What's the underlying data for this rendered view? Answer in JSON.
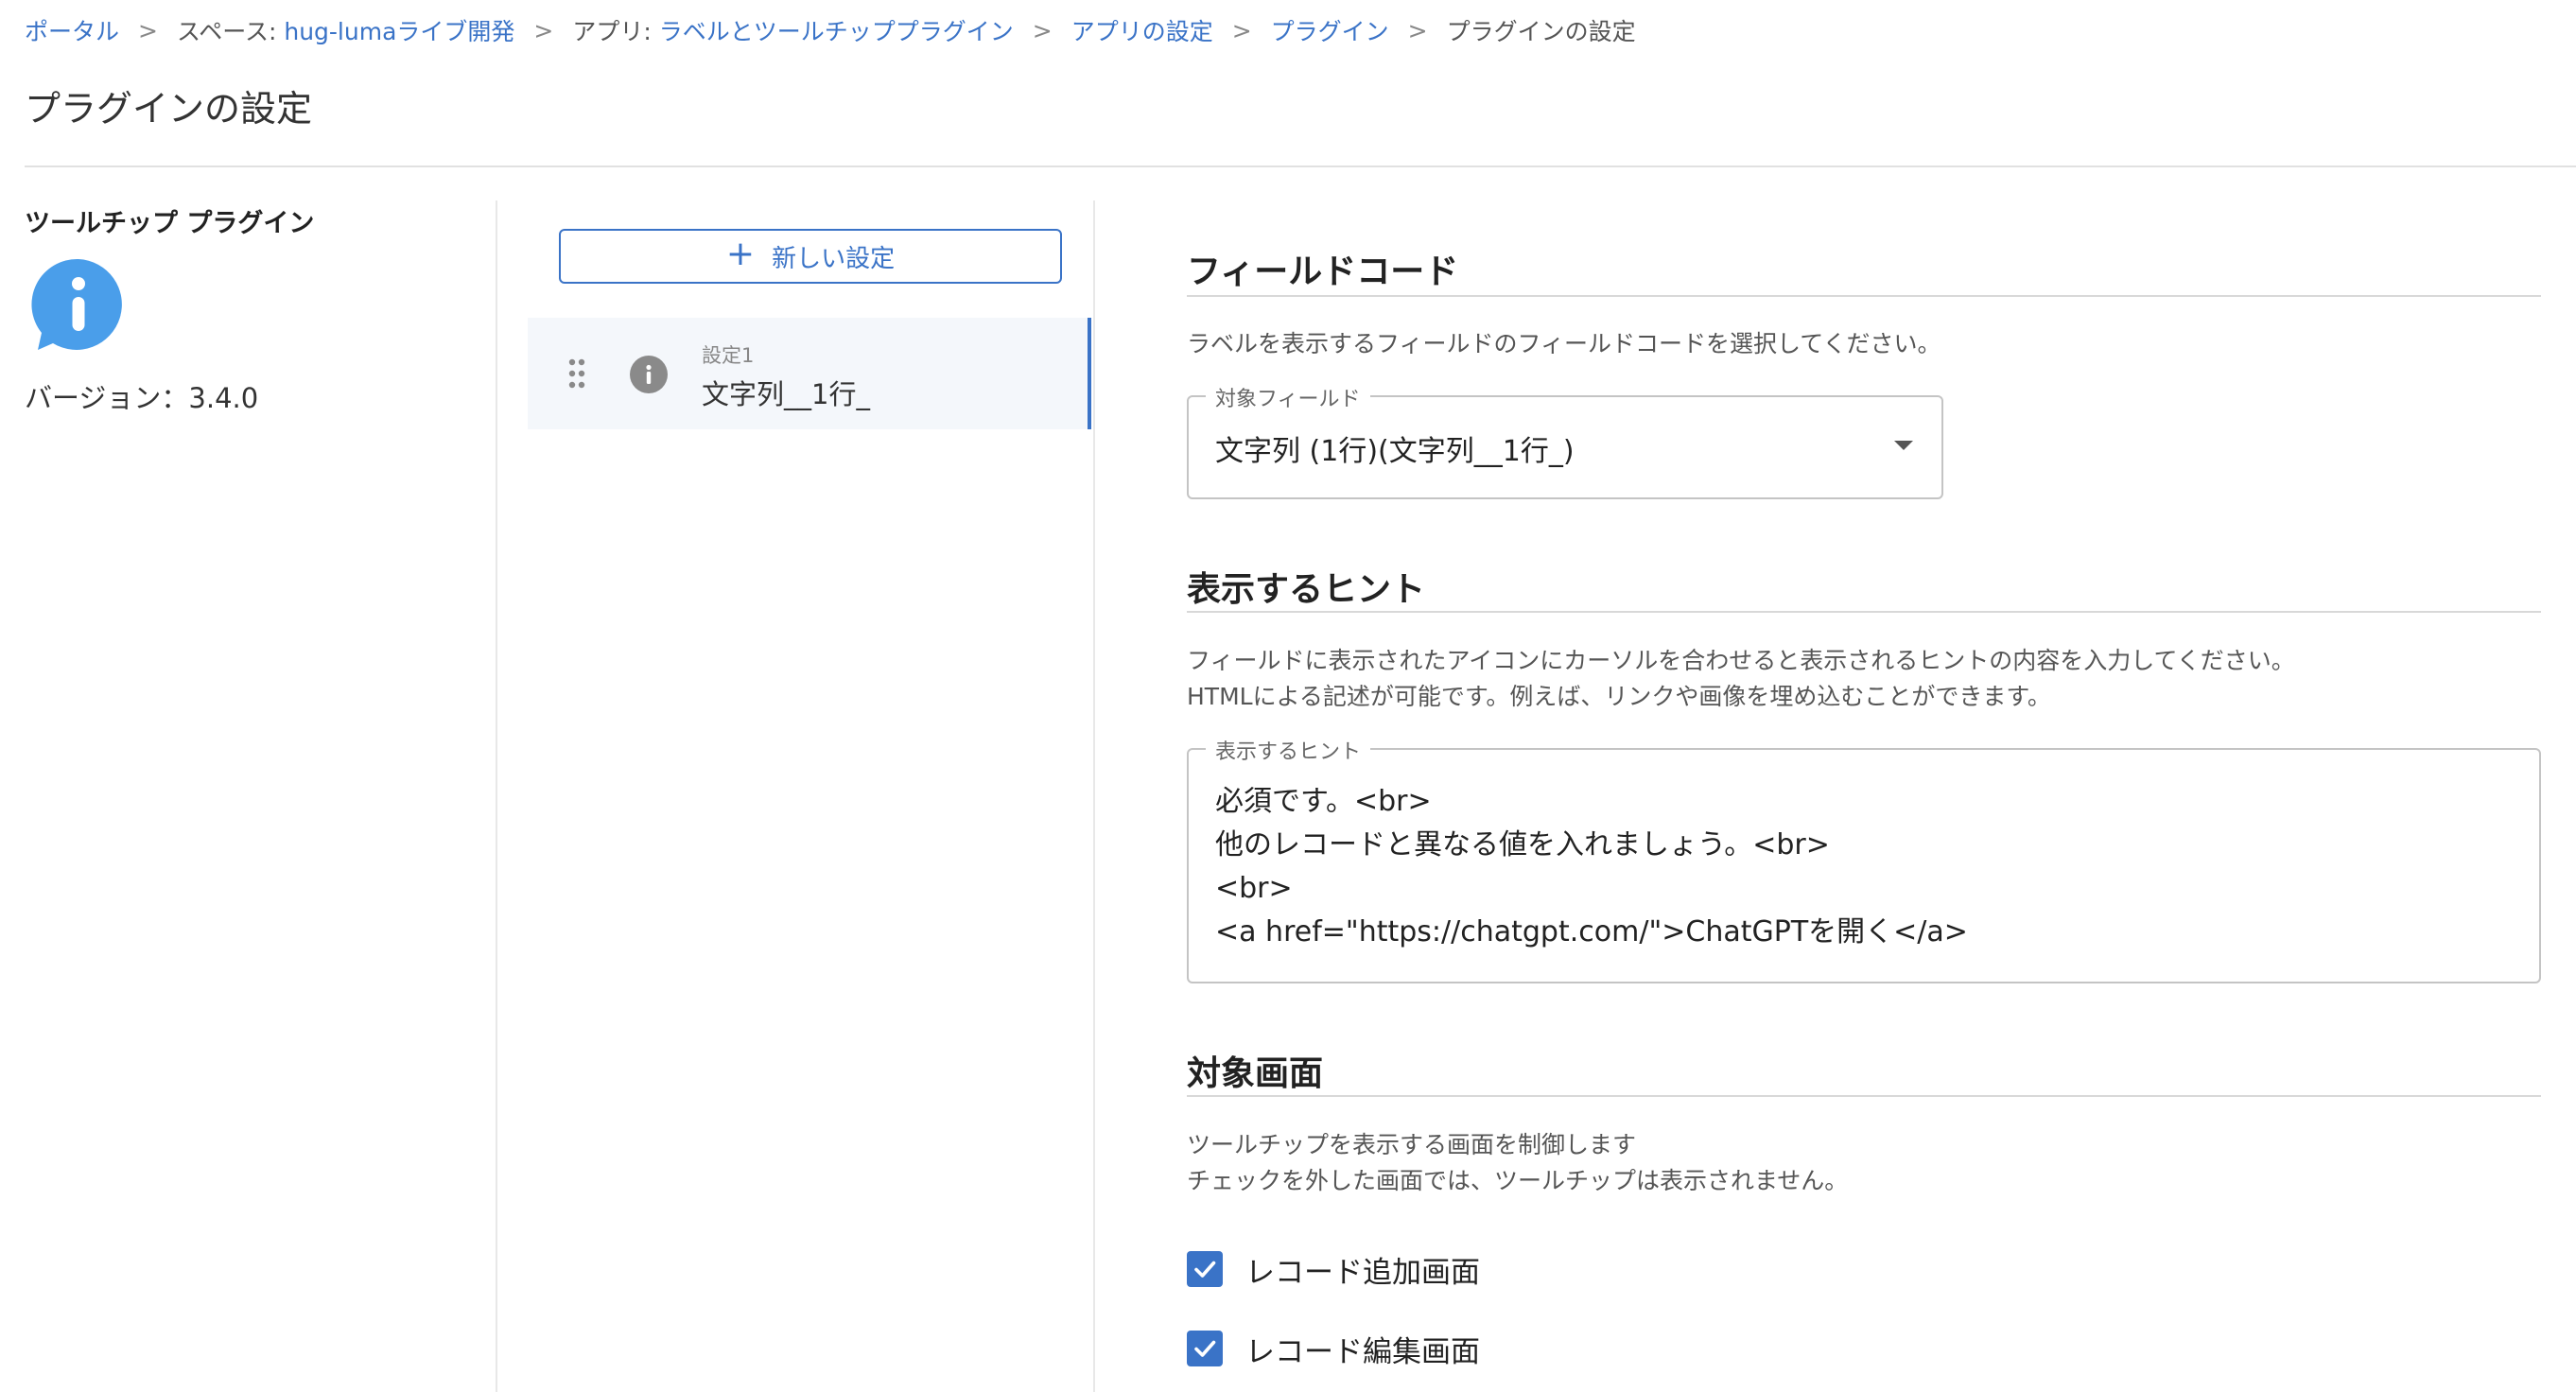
{
  "breadcrumb": [
    {
      "label": "ポータル",
      "link": true
    },
    {
      "label": "スペース: ",
      "link": false
    },
    {
      "label": "hug-lumaライブ開発",
      "link": true
    },
    {
      "label": "アプリ: ",
      "link": false
    },
    {
      "label": "ラベルとツールチッププラグイン",
      "link": true
    },
    {
      "label": "アプリの設定",
      "link": true
    },
    {
      "label": "プラグイン",
      "link": true
    },
    {
      "label": "プラグインの設定",
      "link": false
    }
  ],
  "breadcrumb_sep": ">",
  "page_title": "プラグインの設定",
  "plugin": {
    "name": "ツールチップ プラグイン",
    "icon": "info-bubble-icon",
    "version_label": "バージョン：3.4.0",
    "icon_color": "#4a9eea"
  },
  "settings_list": {
    "new_button_label": "新しい設定",
    "items": [
      {
        "label": "設定1",
        "value": "文字列__1行_",
        "icon": "info-icon"
      }
    ]
  },
  "field_code": {
    "title": "フィールドコード",
    "description": "ラベルを表示するフィールドのフィールドコードを選択してください。",
    "select_legend": "対象フィールド",
    "select_value": "文字列 (1行)(文字列__1行_)"
  },
  "hint": {
    "title": "表示するヒント",
    "description_lines": [
      "フィールドに表示されたアイコンにカーソルを合わせると表示されるヒントの内容を入力してください。",
      "HTMLによる記述が可能です。例えば、リンクや画像を埋め込むことができます。"
    ],
    "textarea_legend": "表示するヒント",
    "textarea_lines": [
      "必須です。<br>",
      "他のレコードと異なる値を入れましょう。<br>",
      "<br>",
      "<a href=\"https://chatgpt.com/\">ChatGPTを開く</a>"
    ]
  },
  "target_screen": {
    "title": "対象画面",
    "description_lines": [
      "ツールチップを表示する画面を制御します",
      "チェックを外した画面では、ツールチップは表示されません。"
    ],
    "checkboxes": [
      {
        "label": "レコード追加画面",
        "checked": true
      },
      {
        "label": "レコード編集画面",
        "checked": true
      }
    ]
  },
  "colors": {
    "accent": "#3a73c7",
    "text": "#333333"
  }
}
